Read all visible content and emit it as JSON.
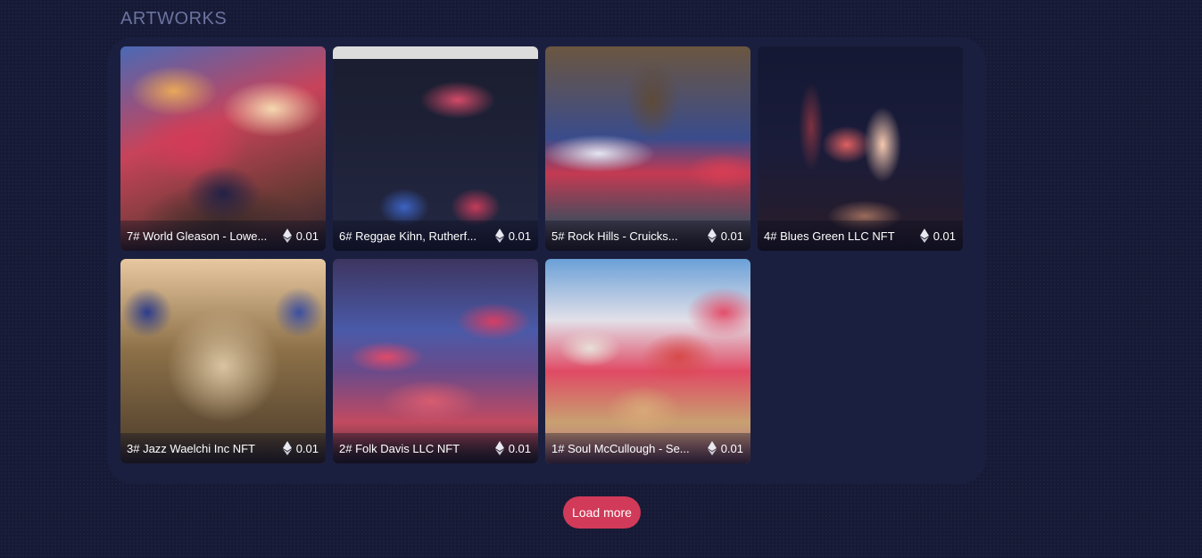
{
  "section": {
    "title": "ARTWORKS"
  },
  "artworks": [
    {
      "name": "7# World Gleason - Lowe...",
      "price": "0.01"
    },
    {
      "name": "6# Reggae Kihn, Rutherf...",
      "price": "0.01"
    },
    {
      "name": "5# Rock Hills - Cruicks...",
      "price": "0.01"
    },
    {
      "name": "4# Blues Green LLC NFT",
      "price": "0.01"
    },
    {
      "name": "3# Jazz Waelchi Inc NFT",
      "price": "0.01"
    },
    {
      "name": "2# Folk Davis LLC NFT",
      "price": "0.01"
    },
    {
      "name": "1# Soul McCullough - Se...",
      "price": "0.01"
    }
  ],
  "currency_icon": "ethereum-icon",
  "load_more": {
    "label": "Load more"
  },
  "colors": {
    "background": "#161a36",
    "accent": "#d23a59",
    "title": "#6b739f"
  }
}
